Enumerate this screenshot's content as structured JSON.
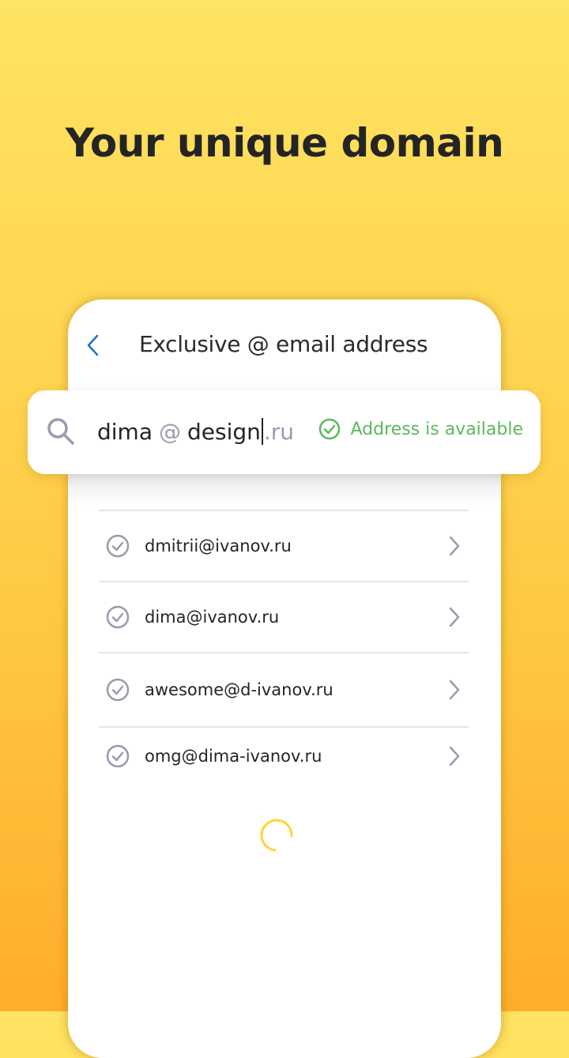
{
  "headline": "Your unique domain",
  "screen": {
    "title": "Exclusive @ email address",
    "back_icon": "chevron-left-icon"
  },
  "search": {
    "icon": "search-icon",
    "local_part": "dima",
    "at_sign": "@",
    "domain_typed": "design",
    "domain_suffix": ".ru",
    "status_icon": "check-circle-icon",
    "status_text": "Address is available"
  },
  "suggestions": [
    {
      "email": "dmitrii@ivanov.ru"
    },
    {
      "email": "dima@ivanov.ru"
    },
    {
      "email": "awesome@d-ivanov.ru"
    },
    {
      "email": "omg@dima-ivanov.ru"
    }
  ],
  "loading": true,
  "colors": {
    "accent_blue": "#1a73c9",
    "available_green": "#5cb85c",
    "spinner_yellow": "#ffd633",
    "icon_gray": "#9a9ab0"
  }
}
